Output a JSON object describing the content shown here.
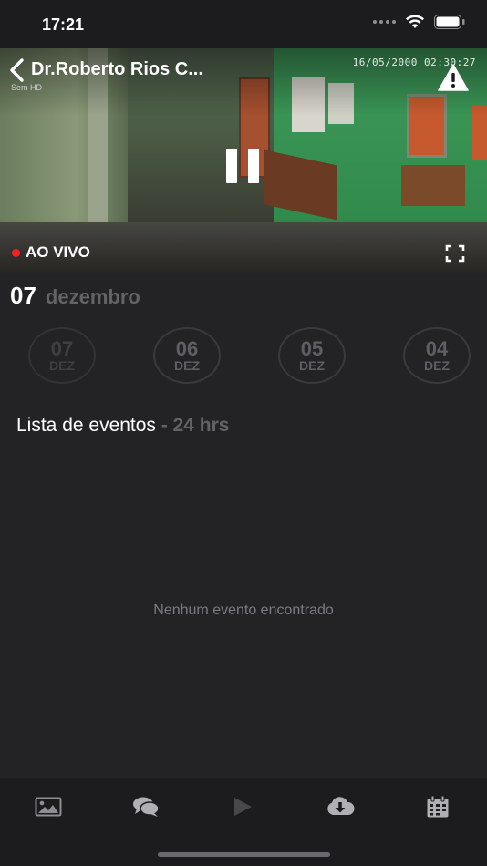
{
  "status_bar": {
    "time": "17:21",
    "icons": [
      "cellular-dots-icon",
      "wifi-icon",
      "battery-icon"
    ]
  },
  "camera": {
    "title": "Dr.Roberto Rios  C...",
    "timestamp": "16/05/2000 02:30:27",
    "quality": "Sem HD",
    "live_label": "AO VIVO",
    "live_color": "#ff1e1e"
  },
  "date": {
    "day": "07",
    "month": "dezembro"
  },
  "days": [
    {
      "num": "07",
      "month": "DEZ",
      "state": "muted"
    },
    {
      "num": "06",
      "month": "DEZ",
      "state": "normal"
    },
    {
      "num": "05",
      "month": "DEZ",
      "state": "normal"
    },
    {
      "num": "04",
      "month": "DEZ",
      "state": "normal"
    }
  ],
  "events": {
    "title": "Lista de eventos",
    "range": "- 24 hrs",
    "empty_message": "Nenhum evento encontrado"
  },
  "tabbar": {
    "items": [
      "gallery-icon",
      "chat-icon",
      "play-icon",
      "cloud-download-icon",
      "calendar-icon"
    ]
  }
}
